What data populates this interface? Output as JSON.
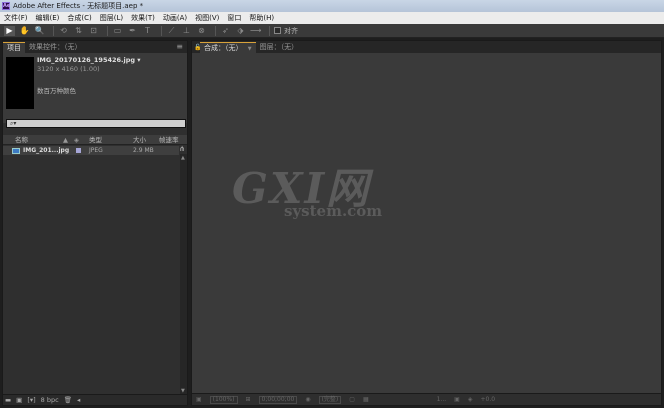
{
  "window": {
    "app_logo": "Ae",
    "title": "Adobe After Effects - 无标题项目.aep *"
  },
  "menu": [
    "文件(F)",
    "编辑(E)",
    "合成(C)",
    "图层(L)",
    "效果(T)",
    "动画(A)",
    "视图(V)",
    "窗口",
    "帮助(H)"
  ],
  "toolbar": {
    "tools": [
      "▶",
      "✋",
      "🔍",
      "⟲",
      "⇅",
      "⊡",
      "▭",
      "✒",
      "T",
      "⟋",
      "⊥",
      "⊗",
      "➶",
      "⬗",
      "⟶"
    ],
    "snap_label": "对齐"
  },
  "project_panel": {
    "tabs": [
      "项目",
      "效果控件：（无）"
    ],
    "menu_icon": "≡",
    "selected_file": {
      "name": "IMG_20170126_195426.jpg ▾",
      "dimensions": "3120 x 4160 (1.00)",
      "color_info": "数百万种颜色"
    },
    "search_placeholder": "⌕▾",
    "columns": [
      "名称",
      "类型",
      "大小",
      "帧速率"
    ],
    "items": [
      {
        "name": "IMG_201...jpg",
        "type": "JPEG",
        "size": "2.9 MB"
      }
    ],
    "footer": {
      "bpc": "8 bpc",
      "interpret": "[▾]",
      "trash": "🗑",
      "scroll_left": "◂"
    }
  },
  "composition_panel": {
    "tabs": [
      "合成：（无）",
      "图层：（无）"
    ],
    "lock_icon": "🔓",
    "footer": {
      "zoom": "(100%)",
      "timecode": "0;00;00;00",
      "resolution": "(完整)",
      "views": "1...",
      "exposure": "+0.0"
    }
  },
  "watermark": {
    "title": "GXI网",
    "subtitle": "system.com"
  }
}
